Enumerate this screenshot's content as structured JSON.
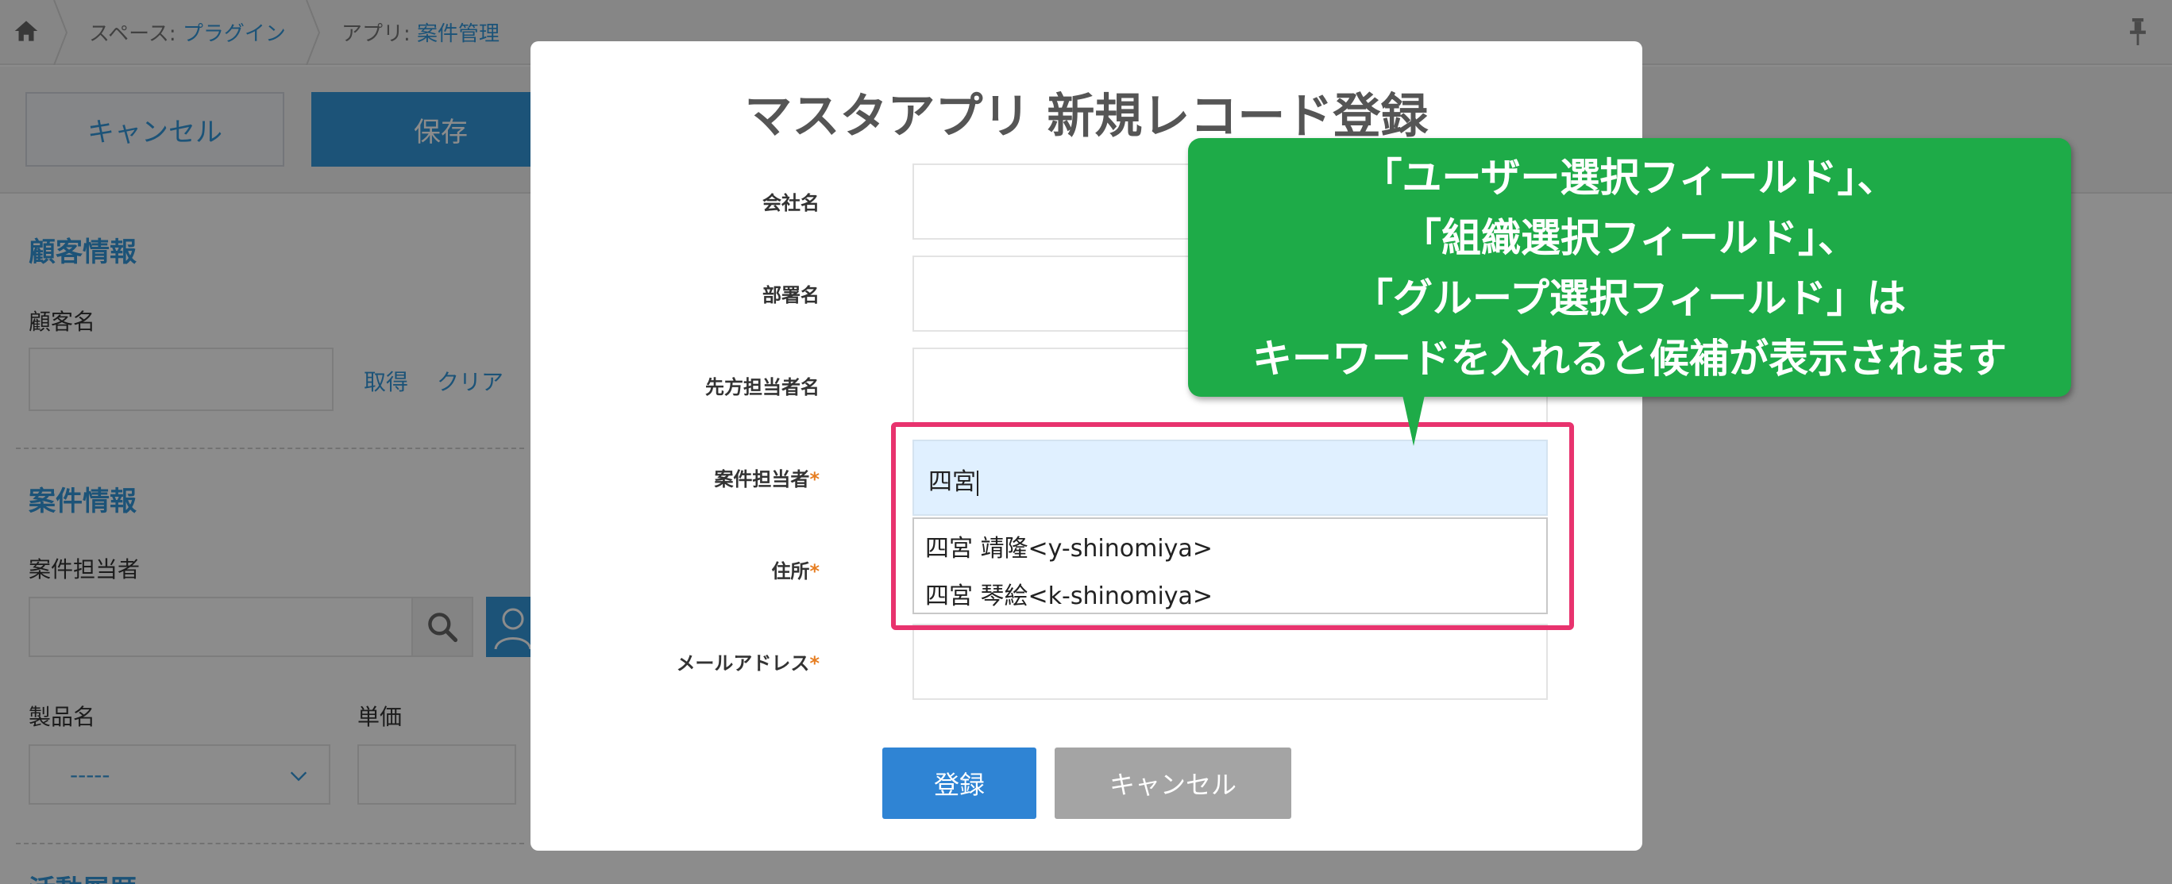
{
  "breadcrumb": {
    "items": [
      {
        "prefix": "スペース: ",
        "link": "プラグイン"
      },
      {
        "prefix": "アプリ: ",
        "link": "案件管理"
      }
    ]
  },
  "toolbar": {
    "cancel_label": "キャンセル",
    "save_label": "保存"
  },
  "form": {
    "section_customer": "顧客情報",
    "customer_name_label": "顧客名",
    "fetch_link": "取得",
    "clear_link": "クリア",
    "section_project": "案件情報",
    "assignee_label": "案件担当者",
    "product_label": "製品名",
    "product_value": "-----",
    "unit_price_label": "単価",
    "section_activity": "活動履歴"
  },
  "modal": {
    "title": "マスタアプリ 新規レコード登録",
    "fields": [
      {
        "label": "会社名",
        "required": false,
        "value": ""
      },
      {
        "label": "部署名",
        "required": false,
        "value": ""
      },
      {
        "label": "先方担当者名",
        "required": false,
        "value": ""
      },
      {
        "label": "案件担当者",
        "required": true,
        "value": "四宮"
      },
      {
        "label": "住所",
        "required": true,
        "value": ""
      },
      {
        "label": "メールアドレス",
        "required": true,
        "value": ""
      }
    ],
    "required_mark": "*",
    "suggestions": [
      "四宮 靖隆<y-shinomiya>",
      "四宮 琴絵<k-shinomiya>"
    ],
    "register_label": "登録",
    "cancel_label": "キャンセル"
  },
  "callout": {
    "lines": [
      "「ユーザー選択フィールド」、",
      "「組織選択フィールド」、",
      "「グループ選択フィールド」は",
      "キーワードを入れると候補が表示されます"
    ]
  },
  "colors": {
    "accent": "#3498db",
    "register": "#2f84d4",
    "callout": "#1eab48",
    "highlight": "#e8336e",
    "required": "#e67e22"
  }
}
